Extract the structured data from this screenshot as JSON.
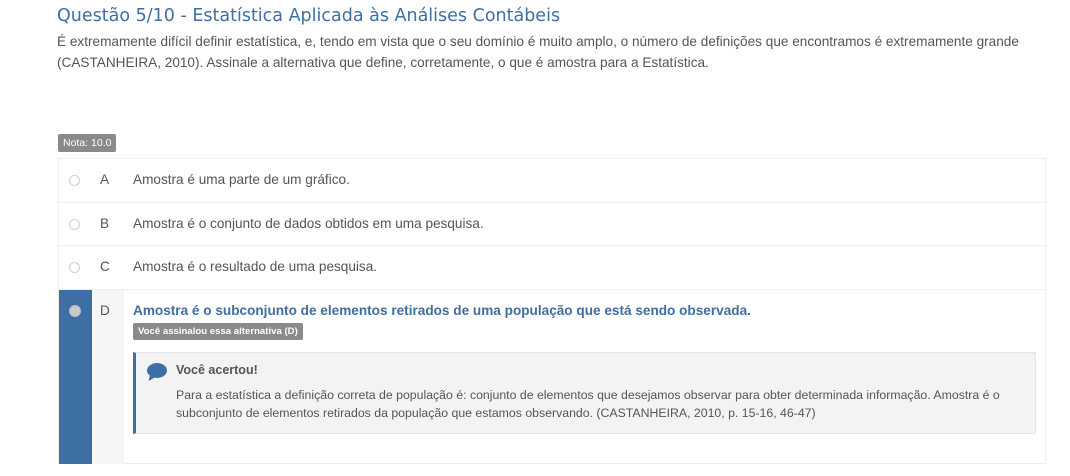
{
  "question": {
    "title": "Questão 5/10 - Estatística Aplicada às Análises Contábeis",
    "text": "É extremamente difícil definir estatística, e, tendo em vista que o seu domínio é muito amplo, o número de definições que encontramos é extremamente grande (CASTANHEIRA, 2010).  Assinale a alternativa que define, corretamente, o que é amostra para a Estatística."
  },
  "nota": {
    "label": "Nota: 10.0",
    "value": 10.0
  },
  "options": [
    {
      "letter": "A",
      "text": "Amostra é uma parte de um gráfico.",
      "selected": false
    },
    {
      "letter": "B",
      "text": "Amostra é o conjunto de dados obtidos em uma pesquisa.",
      "selected": false
    },
    {
      "letter": "C",
      "text": "Amostra é o resultado de uma pesquisa.",
      "selected": false
    },
    {
      "letter": "D",
      "text": "Amostra é o subconjunto de elementos retirados de uma população que está sendo observada.",
      "selected": true
    }
  ],
  "selected_badge": "Você assinalou essa alternativa (D)",
  "feedback": {
    "icon": "chat-bubble-icon",
    "title": "Você acertou!",
    "text": "Para a estatística a definição correta de população é: conjunto de elementos que desejamos observar para obter determinada informação. Amostra é o subconjunto de elementos retirados da população que estamos observando. (CASTANHEIRA, 2010, p. 15-16, 46-47)"
  },
  "colors": {
    "accent": "#3d6ea4",
    "title": "#3f6ea3",
    "badge": "#8a8a8a",
    "text": "#555555"
  }
}
